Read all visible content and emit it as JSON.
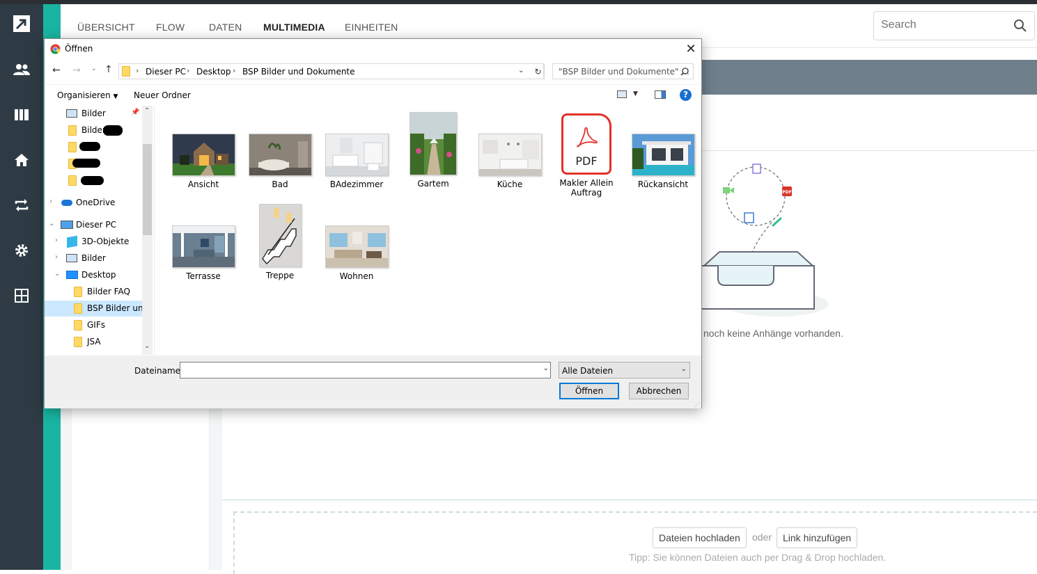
{
  "app": {
    "nav_tabs": [
      "ÜBERSICHT",
      "FLOW",
      "DATEN",
      "MULTIMEDIA",
      "EINHEITEN"
    ],
    "active_tab": "MULTIMEDIA",
    "search_placeholder": "Search",
    "rail_icons": [
      "logo-icon",
      "users-icon",
      "board-icon",
      "home-icon",
      "repeat-icon",
      "settings-icon",
      "grid-icon"
    ],
    "empty_text": "noch keine Anhänge vorhanden.",
    "upload_button": "Dateien hochladen",
    "or_text": "oder",
    "link_button": "Link hinzufügen",
    "tip_text": "Tipp: Sie können Dateien auch per Drag & Drop hochladen.",
    "accent_color": "#1ab5a2",
    "rail_color": "#2e3b44"
  },
  "dialog": {
    "title": "Öffnen",
    "breadcrumb": [
      "Dieser PC",
      "Desktop",
      "BSP Bilder und Dokumente"
    ],
    "search_placeholder": "\"BSP Bilder und Dokumente\" ...",
    "toolbar": {
      "organize": "Organisieren",
      "new_folder": "Neuer Ordner"
    },
    "nav_items": [
      {
        "label": "Bilder",
        "icon": "pictures-icon"
      },
      {
        "label": "Bilder",
        "icon": "folder-icon",
        "redacted": true
      },
      {
        "label": "",
        "icon": "folder-icon",
        "redacted": true
      },
      {
        "label": "",
        "icon": "folder-icon",
        "redacted": true
      },
      {
        "label": "",
        "icon": "folder-icon",
        "redacted": true
      },
      {
        "label": "OneDrive",
        "icon": "onedrive-icon"
      },
      {
        "label": "Dieser PC",
        "icon": "pc-icon"
      },
      {
        "label": "3D-Objekte",
        "icon": "3d-objects-icon"
      },
      {
        "label": "Bilder",
        "icon": "pictures-icon"
      },
      {
        "label": "Desktop",
        "icon": "desktop-icon"
      },
      {
        "label": "Bilder FAQ",
        "icon": "folder-icon"
      },
      {
        "label": "BSP Bilder und",
        "icon": "folder-icon",
        "selected": true
      },
      {
        "label": "GIFs",
        "icon": "folder-icon"
      },
      {
        "label": "JSA",
        "icon": "folder-icon"
      }
    ],
    "files": [
      {
        "name": "Ansicht",
        "kind": "image"
      },
      {
        "name": "Bad",
        "kind": "image"
      },
      {
        "name": "BAdezimmer",
        "kind": "image"
      },
      {
        "name": "Gartem",
        "kind": "image"
      },
      {
        "name": "Küche",
        "kind": "image"
      },
      {
        "name": "Makler Allein Auftrag",
        "kind": "pdf"
      },
      {
        "name": "Rückansicht",
        "kind": "image"
      },
      {
        "name": "Terrasse",
        "kind": "image"
      },
      {
        "name": "Treppe",
        "kind": "image"
      },
      {
        "name": "Wohnen",
        "kind": "image"
      }
    ],
    "pdf_label": "PDF",
    "filename_label": "Dateiname:",
    "filename_value": "",
    "filetype_value": "Alle Dateien",
    "open_button": "Öffnen",
    "cancel_button": "Abbrechen"
  }
}
